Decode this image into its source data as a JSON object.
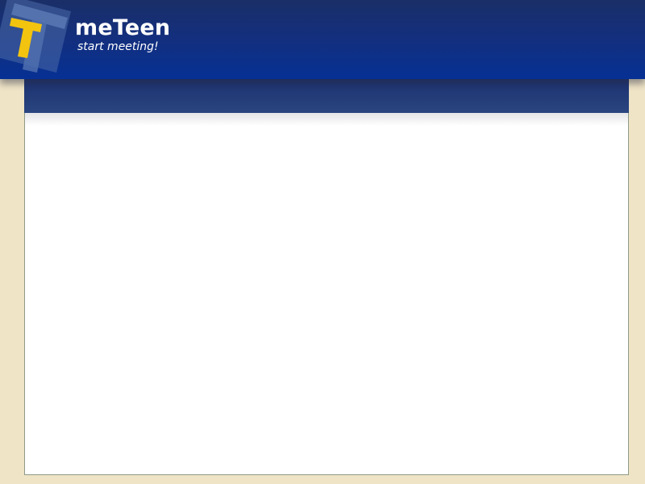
{
  "app": {
    "name": "meTeen",
    "tagline": "start meeting!"
  },
  "logo": {
    "icon": "t-logo-icon",
    "letter_color": "#f2c40f",
    "block_color": "#3a5a9e"
  },
  "colors": {
    "header": "#0a2f8e",
    "subbar": "#243c78",
    "page_background": "#efe4c6",
    "panel_background": "#ffffff"
  }
}
